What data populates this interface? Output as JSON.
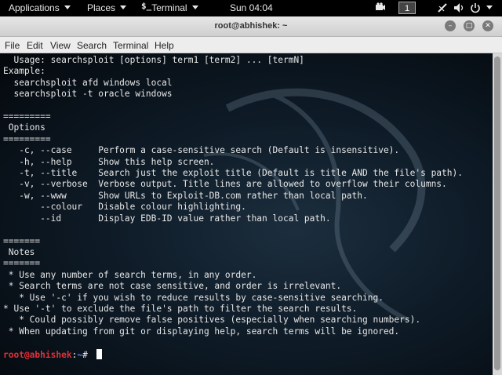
{
  "topbar": {
    "applications": "Applications",
    "places": "Places",
    "terminal": "Terminal",
    "terminal_icon": "$_",
    "clock": "Sun 04:04",
    "workspace": "1"
  },
  "window": {
    "title": "root@abhishek: ~"
  },
  "menu": {
    "items": [
      "File",
      "Edit",
      "View",
      "Search",
      "Terminal",
      "Help"
    ]
  },
  "terminal": {
    "lines": [
      "  Usage: searchsploit [options] term1 [term2] ... [termN]",
      "Example:",
      "  searchsploit afd windows local",
      "  searchsploit -t oracle windows",
      "",
      "=========",
      " Options",
      "=========",
      "   -c, --case     Perform a case-sensitive search (Default is insensitive).",
      "   -h, --help     Show this help screen.",
      "   -t, --title    Search just the exploit title (Default is title AND the file's path).",
      "   -v, --verbose  Verbose output. Title lines are allowed to overflow their columns.",
      "   -w, --www      Show URLs to Exploit-DB.com rather than local path.",
      "       --colour   Disable colour highlighting.",
      "       --id       Display EDB-ID value rather than local path.",
      "",
      "=======",
      " Notes",
      "=======",
      " * Use any number of search terms, in any order.",
      " * Search terms are not case sensitive, and order is irrelevant.",
      "   * Use '-c' if you wish to reduce results by case-sensitive searching.",
      "* Use '-t' to exclude the file's path to filter the search results.",
      "   * Could possibly remove false positives (especially when searching numbers).",
      " * When updating from git or displaying help, search terms will be ignored."
    ],
    "prompt_user": "root@abhishek",
    "prompt_sep": ":",
    "prompt_path": "~",
    "prompt_symbol": "# "
  }
}
